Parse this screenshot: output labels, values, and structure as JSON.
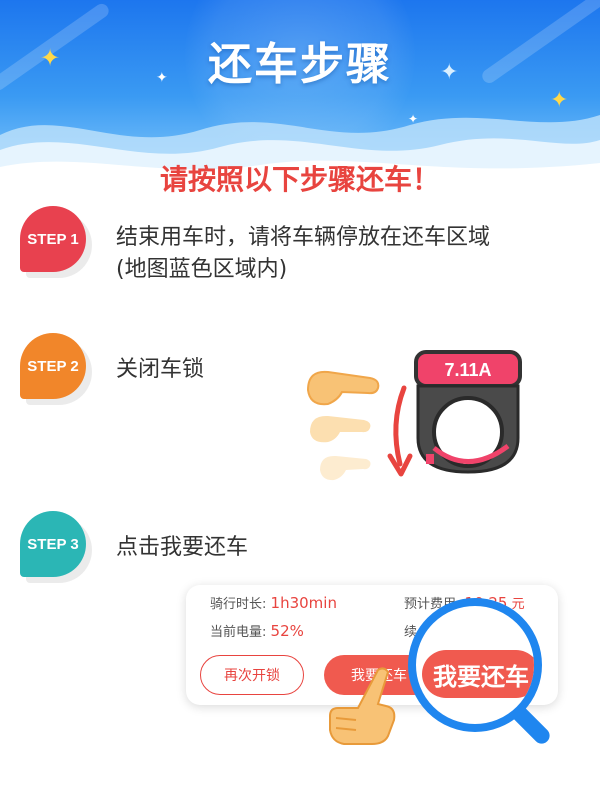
{
  "header": {
    "title": "还车步骤"
  },
  "subtitle": "请按照以下步骤还车！",
  "steps": [
    {
      "badge": "STEP 1",
      "text_line1": "结束用车时，请将车辆停放在还车区域",
      "text_line2": "(地图蓝色区域内)"
    },
    {
      "badge": "STEP 2",
      "text_line1": "关闭车锁"
    },
    {
      "badge": "STEP 3",
      "text_line1": "点击我要还车"
    }
  ],
  "lock": {
    "brand": "7.11A"
  },
  "card": {
    "ride_time_label": "骑行时长:",
    "ride_time_value": "1h30min",
    "est_fee_label": "预计费用:",
    "est_fee_value": "10.25",
    "est_fee_unit": "元",
    "battery_label": "当前电量:",
    "battery_value": "52%",
    "range_label": "续",
    "reopen_label": "再次开锁",
    "return_label": "我要还车",
    "magnified_return_label": "我要还车"
  },
  "colors": {
    "header_blue": "#1d76ee",
    "accent_red": "#e8443f",
    "step1": "#e8414f",
    "step2": "#f1862a",
    "step3": "#2bb6b5"
  }
}
